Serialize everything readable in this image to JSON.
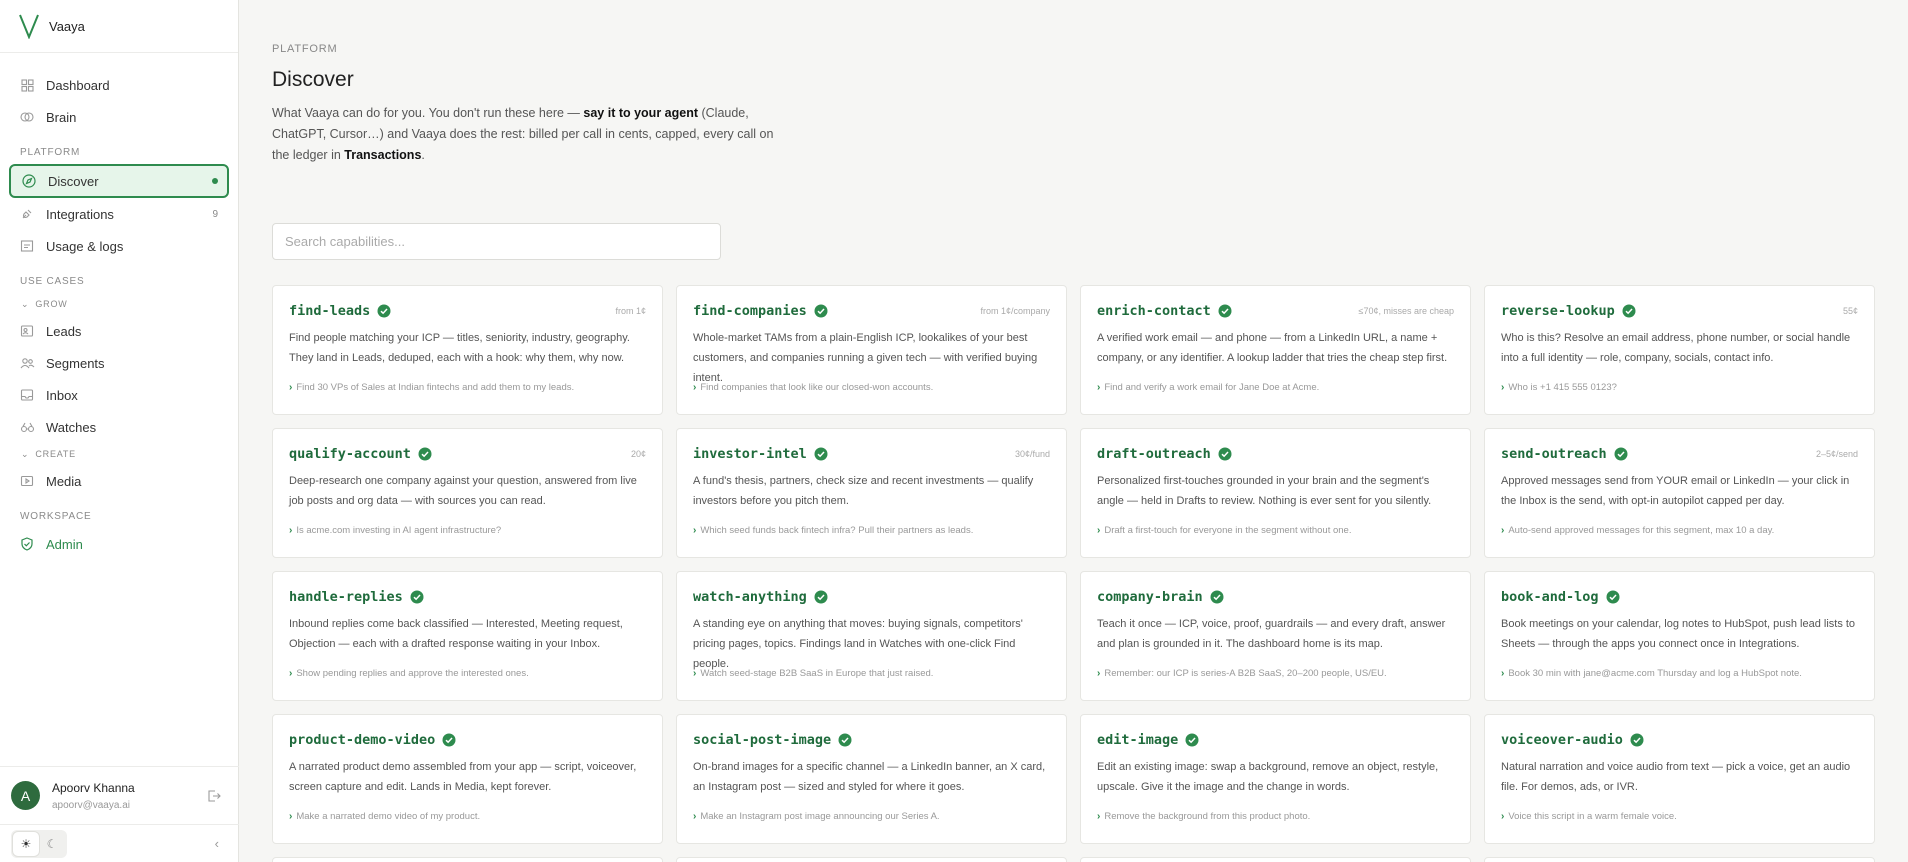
{
  "brand": {
    "name": "Vaaya"
  },
  "sidebar": {
    "top_items": [
      {
        "label": "Dashboard",
        "icon": "grid-icon"
      },
      {
        "label": "Brain",
        "icon": "brain-icon"
      }
    ],
    "platform_label": "PLATFORM",
    "platform_items": [
      {
        "label": "Discover",
        "icon": "compass-icon",
        "active": true
      },
      {
        "label": "Integrations",
        "icon": "plug-icon",
        "count": "9"
      },
      {
        "label": "Usage & logs",
        "icon": "receipt-icon"
      }
    ],
    "use_cases_label": "USE CASES",
    "grow_label": "GROW",
    "grow_items": [
      {
        "label": "Leads",
        "icon": "user-icon"
      },
      {
        "label": "Segments",
        "icon": "users-icon"
      },
      {
        "label": "Inbox",
        "icon": "inbox-icon"
      },
      {
        "label": "Watches",
        "icon": "binoculars-icon"
      }
    ],
    "create_label": "CREATE",
    "create_items": [
      {
        "label": "Media",
        "icon": "play-icon"
      }
    ],
    "workspace_label": "WORKSPACE",
    "workspace_items": [
      {
        "label": "Admin",
        "icon": "shield-check-icon"
      }
    ]
  },
  "user": {
    "initial": "A",
    "name": "Apoorv Khanna",
    "email": "apoorv@vaaya.ai"
  },
  "main": {
    "overline": "PLATFORM",
    "title": "Discover",
    "intro_part1": "What Vaaya can do for you. You don't run these here — ",
    "intro_bold1": "say it to your agent",
    "intro_part2": " (Claude, ChatGPT, Cursor…) and Vaaya does the rest: billed per call in cents, capped, every call on the ledger in ",
    "intro_bold2": "Transactions",
    "intro_part3": ".",
    "search_placeholder": "Search capabilities..."
  },
  "cards": [
    {
      "name": "find-leads",
      "price": "from 1¢",
      "desc": "Find people matching your ICP — titles, seniority, industry, geography. They land in Leads, deduped, each with a hook: why them, why now.",
      "example": "Find 30 VPs of Sales at Indian fintechs and add them to my leads."
    },
    {
      "name": "find-companies",
      "price": "from 1¢/company",
      "desc": "Whole-market TAMs from a plain-English ICP, lookalikes of your best customers, and companies running a given tech — with verified buying intent.",
      "example": "Find companies that look like our closed-won accounts."
    },
    {
      "name": "enrich-contact",
      "price": "≤70¢, misses are cheap",
      "desc": "A verified work email — and phone — from a LinkedIn URL, a name + company, or any identifier. A lookup ladder that tries the cheap step first.",
      "example": "Find and verify a work email for Jane Doe at Acme."
    },
    {
      "name": "reverse-lookup",
      "price": "55¢",
      "desc": "Who is this? Resolve an email address, phone number, or social handle into a full identity — role, company, socials, contact info.",
      "example": "Who is +1 415 555 0123?"
    },
    {
      "name": "qualify-account",
      "price": "20¢",
      "desc": "Deep-research one company against your question, answered from live job posts and org data — with sources you can read.",
      "example": "Is acme.com investing in AI agent infrastructure?"
    },
    {
      "name": "investor-intel",
      "price": "30¢/fund",
      "desc": "A fund's thesis, partners, check size and recent investments — qualify investors before you pitch them.",
      "example": "Which seed funds back fintech infra? Pull their partners as leads."
    },
    {
      "name": "draft-outreach",
      "price": "",
      "desc": "Personalized first-touches grounded in your brain and the segment's angle — held in Drafts to review. Nothing is ever sent for you silently.",
      "example": "Draft a first-touch for everyone in the segment without one."
    },
    {
      "name": "send-outreach",
      "price": "2–5¢/send",
      "desc": "Approved messages send from YOUR email or LinkedIn — your click in the Inbox is the send, with opt-in autopilot capped per day.",
      "example": "Auto-send approved messages for this segment, max 10 a day."
    },
    {
      "name": "handle-replies",
      "price": "",
      "desc": "Inbound replies come back classified — Interested, Meeting request, Objection — each with a drafted response waiting in your Inbox.",
      "example": "Show pending replies and approve the interested ones."
    },
    {
      "name": "watch-anything",
      "price": "",
      "desc": "A standing eye on anything that moves: buying signals, competitors' pricing pages, topics. Findings land in Watches with one-click Find people.",
      "example": "Watch seed-stage B2B SaaS in Europe that just raised."
    },
    {
      "name": "company-brain",
      "price": "",
      "desc": "Teach it once — ICP, voice, proof, guardrails — and every draft, answer and plan is grounded in it. The dashboard home is its map.",
      "example": "Remember: our ICP is series-A B2B SaaS, 20–200 people, US/EU."
    },
    {
      "name": "book-and-log",
      "price": "",
      "desc": "Book meetings on your calendar, log notes to HubSpot, push lead lists to Sheets — through the apps you connect once in Integrations.",
      "example": "Book 30 min with jane@acme.com Thursday and log a HubSpot note."
    },
    {
      "name": "product-demo-video",
      "price": "",
      "desc": "A narrated product demo assembled from your app — script, voiceover, screen capture and edit. Lands in Media, kept forever.",
      "example": "Make a narrated demo video of my product."
    },
    {
      "name": "social-post-image",
      "price": "",
      "desc": "On-brand images for a specific channel — a LinkedIn banner, an X card, an Instagram post — sized and styled for where it goes.",
      "example": "Make an Instagram post image announcing our Series A."
    },
    {
      "name": "edit-image",
      "price": "",
      "desc": "Edit an existing image: swap a background, remove an object, restyle, upscale. Give it the image and the change in words.",
      "example": "Remove the background from this product photo."
    },
    {
      "name": "voiceover-audio",
      "price": "",
      "desc": "Natural narration and voice audio from text — pick a voice, get an audio file. For demos, ads, or IVR.",
      "example": "Voice this script in a warm female voice."
    }
  ],
  "colors": {
    "accent": "#2e8b4e",
    "accent_text": "#1f6b3c",
    "active_bg": "#e6f5ea"
  }
}
